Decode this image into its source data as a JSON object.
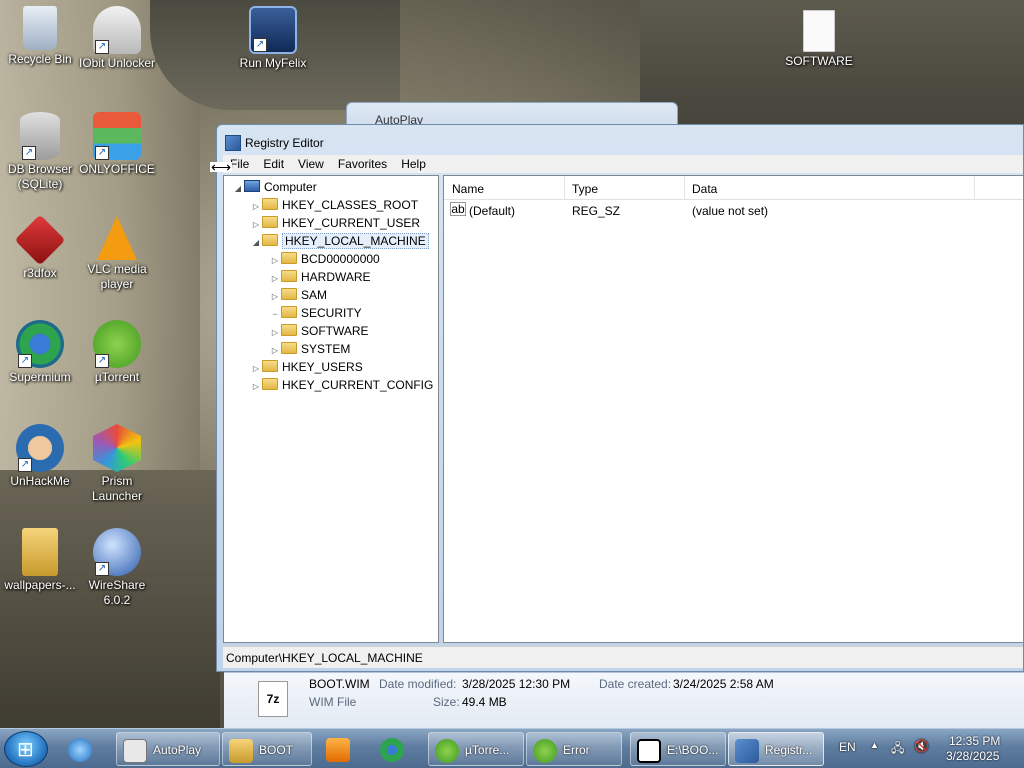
{
  "desktop": {
    "icons": [
      {
        "label": "Recycle Bin",
        "icon": "recycle-bin-icon"
      },
      {
        "label": "IObit Unlocker",
        "icon": "unlocker-icon"
      },
      {
        "label": "Run MyFelix",
        "icon": "myfelix-icon"
      },
      {
        "label": "SOFTWARE",
        "icon": "document-icon"
      },
      {
        "label": "DB Browser (SQLite)",
        "icon": "database-icon"
      },
      {
        "label": "ONLYOFFICE",
        "icon": "onlyoffice-icon"
      },
      {
        "label": "r3dfox",
        "icon": "r3dfox-icon"
      },
      {
        "label": "VLC media player",
        "icon": "vlc-cone-icon"
      },
      {
        "label": "Supermium",
        "icon": "supermium-icon"
      },
      {
        "label": "µTorrent",
        "icon": "utorrent-icon"
      },
      {
        "label": "UnHackMe",
        "icon": "unhackme-icon"
      },
      {
        "label": "Prism Launcher",
        "icon": "prism-icon"
      },
      {
        "label": "wallpapers-...",
        "icon": "folder-icon"
      },
      {
        "label": "WireShare 6.0.2",
        "icon": "wireshare-icon"
      }
    ]
  },
  "autoplay_window": {
    "title": "AutoPlay"
  },
  "regedit": {
    "title": "Registry Editor",
    "menu": [
      "File",
      "Edit",
      "View",
      "Favorites",
      "Help"
    ],
    "tree": {
      "root": "Computer",
      "hives": [
        "HKEY_CLASSES_ROOT",
        "HKEY_CURRENT_USER",
        "HKEY_LOCAL_MACHINE",
        "HKEY_USERS",
        "HKEY_CURRENT_CONFIG"
      ],
      "selected": "HKEY_LOCAL_MACHINE",
      "hklm_children": [
        "BCD00000000",
        "HARDWARE",
        "SAM",
        "SECURITY",
        "SOFTWARE",
        "SYSTEM"
      ]
    },
    "columns": [
      "Name",
      "Type",
      "Data"
    ],
    "values": [
      {
        "name": "(Default)",
        "type": "REG_SZ",
        "data": "(value not set)"
      }
    ],
    "status_path": "Computer\\HKEY_LOCAL_MACHINE"
  },
  "details_pane": {
    "file_icon_text": "7z",
    "file_name": "BOOT.WIM",
    "date_modified_label": "Date modified:",
    "date_modified": "3/28/2025 12:30 PM",
    "date_created_label": "Date created:",
    "date_created": "3/24/2025 2:58 AM",
    "file_type": "WIM File",
    "size_label": "Size:",
    "size": "49.4 MB"
  },
  "taskbar": {
    "buttons": [
      {
        "label": "AutoPlay",
        "icon": "autoplay-icon"
      },
      {
        "label": "BOOT",
        "icon": "folder-icon"
      },
      {
        "label": "µTorre...",
        "icon": "utorrent-icon"
      },
      {
        "label": "Error",
        "icon": "utorrent-icon"
      },
      {
        "label": "E:\\BOO...",
        "icon": "7zip-icon"
      },
      {
        "label": "Registr...",
        "icon": "regedit-icon"
      }
    ],
    "language": "EN",
    "time": "12:35 PM",
    "date": "3/28/2025",
    "colors": {
      "start_orb": "#2a7cc7",
      "taskbar": "#5f7da0"
    }
  }
}
